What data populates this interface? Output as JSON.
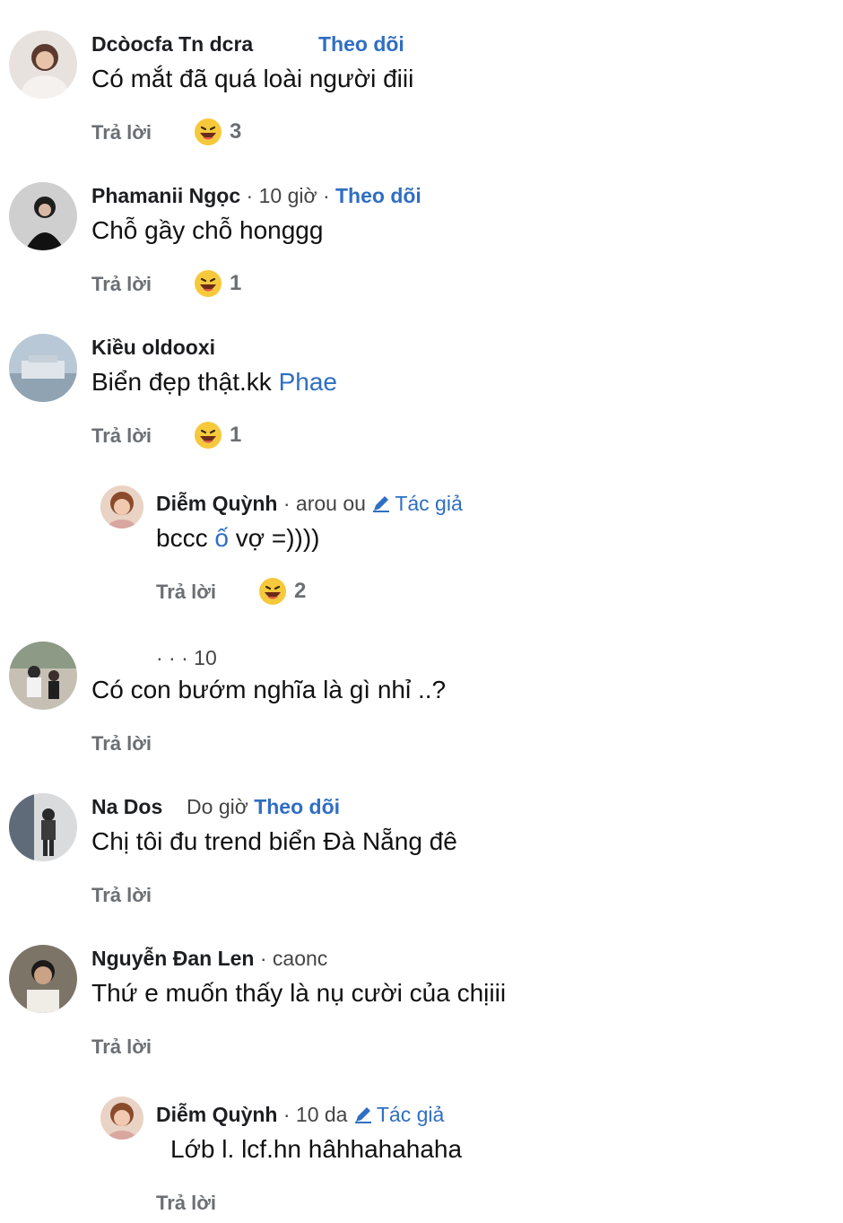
{
  "comments": [
    {
      "name": "Dcòocfa Tn dcra",
      "meta": "",
      "follow": "Theo dõi",
      "text": "Có mắt đã quá loài người điii",
      "reply": "Trả lời",
      "reaction_count": "3"
    },
    {
      "name": "Phamanii Ngọc",
      "meta": "· 10 giờ ·",
      "follow": "Theo dõi",
      "text": "Chỗ gầy chỗ honggg",
      "reply": "Trả lời",
      "reaction_count": "1"
    },
    {
      "name": "Kiều oldooxi",
      "meta": "",
      "follow": "",
      "text": "Biển đẹp thật.kk",
      "mention": "Phae",
      "reply": "Trả lời",
      "reaction_count": "1"
    },
    {
      "name": "Diễm Quỳnh",
      "meta": "· arou ou",
      "author": "Tác giả",
      "text_prefix": "bccc",
      "mention": "ố",
      "text": " vợ =))))",
      "reply": "Trả lời",
      "reaction_count": "2"
    },
    {
      "name": "",
      "meta": "· · · 10",
      "text": "Có con bướm nghĩa là gì nhỉ ..?",
      "reply": "Trả lời"
    },
    {
      "name": "Na Dos",
      "meta": "Do giờ",
      "follow": "Theo dõi",
      "text": "Chị tôi đu trend biển Đà Nẵng đê",
      "reply": "Trả lời"
    },
    {
      "name": "Nguyễn Đan Len",
      "meta": "· caonc",
      "text": "Thứ e muốn thấy là nụ cười của chịiii",
      "reply": "Trả lời"
    },
    {
      "name": "Diễm Quỳnh",
      "meta": "· 10 da",
      "author": "Tác giả",
      "text_prefix": "Lớb l. lcf.hn",
      "text": " hâhhahahaha",
      "reply": "Trả lời"
    }
  ],
  "colors": {
    "link": "#2f6ec4",
    "muted": "#6b6f74",
    "text": "#111111"
  },
  "icons": {
    "reaction": "laughing-face-icon",
    "author_badge": "pencil-icon"
  }
}
